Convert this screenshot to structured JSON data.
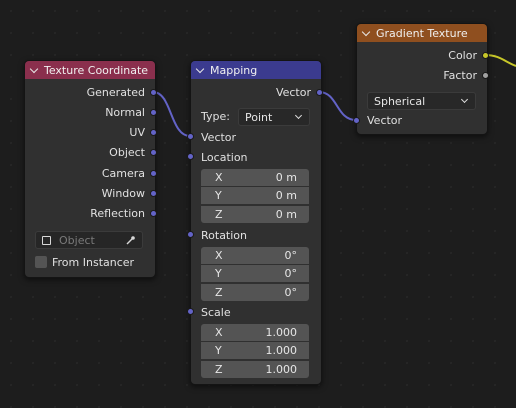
{
  "colors": {
    "texture_coordinate_header": "#8a2f4d",
    "mapping_header": "#3b3b8f",
    "gradient_texture_header": "#8f4f1f",
    "vector_socket": "#6363c7",
    "color_socket": "#c7c729",
    "float_socket": "#a1a1a1"
  },
  "texture_coordinate": {
    "title": "Texture Coordinate",
    "outputs": [
      "Generated",
      "Normal",
      "UV",
      "Object",
      "Camera",
      "Window",
      "Reflection"
    ],
    "object_placeholder": "Object",
    "object_icon": "cube-icon",
    "eyedropper_icon": "eyedropper-icon",
    "from_instancer": "From Instancer"
  },
  "mapping": {
    "title": "Mapping",
    "output": "Vector",
    "type_label": "Type:",
    "type_value": "Point",
    "input_vector": "Vector",
    "location": {
      "label": "Location",
      "x": "0 m",
      "y": "0 m",
      "z": "0 m"
    },
    "rotation": {
      "label": "Rotation",
      "x": "0°",
      "y": "0°",
      "z": "0°"
    },
    "scale": {
      "label": "Scale",
      "x": "1.000",
      "y": "1.000",
      "z": "1.000"
    },
    "axis": {
      "x": "X",
      "y": "Y",
      "z": "Z"
    }
  },
  "gradient_texture": {
    "title": "Gradient Texture",
    "output_color": "Color",
    "output_factor": "Factor",
    "gradient_type": "Spherical",
    "input_vector": "Vector"
  }
}
